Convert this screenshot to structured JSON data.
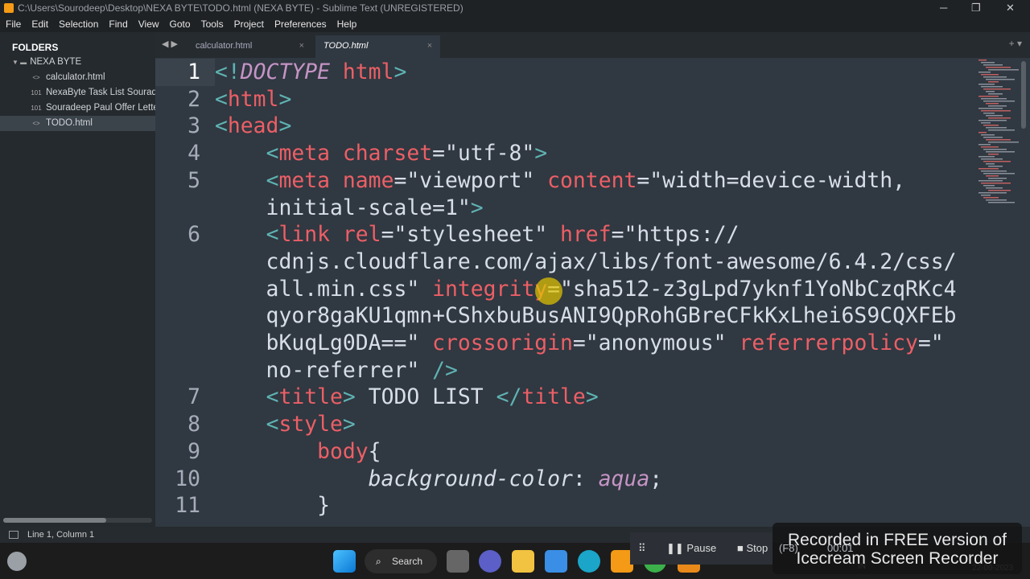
{
  "window": {
    "title": "C:\\Users\\Sourodeep\\Desktop\\NEXA BYTE\\TODO.html (NEXA BYTE) - Sublime Text (UNREGISTERED)",
    "min": "─",
    "max": "❐",
    "close": "✕"
  },
  "menu": [
    "File",
    "Edit",
    "Selection",
    "Find",
    "View",
    "Goto",
    "Tools",
    "Project",
    "Preferences",
    "Help"
  ],
  "sidebar": {
    "header": "FOLDERS",
    "folder": "NEXA BYTE",
    "files": [
      {
        "name": "calculator.html",
        "icon": "<>"
      },
      {
        "name": "NexaByte Task List Sourade",
        "icon": "101"
      },
      {
        "name": "Souradeep Paul Offer Lette",
        "icon": "101"
      },
      {
        "name": "TODO.html",
        "icon": "<>"
      }
    ]
  },
  "tabs": [
    {
      "label": "calculator.html"
    },
    {
      "label": "TODO.html"
    }
  ],
  "tab_close": "×",
  "code": [
    {
      "n": "1",
      "toks": [
        [
          "p",
          "<!"
        ],
        [
          "k",
          "DOCTYPE "
        ],
        [
          "n",
          "html"
        ],
        [
          "p",
          ">"
        ]
      ]
    },
    {
      "n": "2",
      "toks": [
        [
          "p",
          "<"
        ],
        [
          "n",
          "html"
        ],
        [
          "p",
          ">"
        ]
      ]
    },
    {
      "n": "3",
      "toks": [
        [
          "p",
          "<"
        ],
        [
          "n",
          "head"
        ],
        [
          "p",
          ">"
        ]
      ]
    },
    {
      "n": "4",
      "toks": [
        [
          "s",
          "    "
        ],
        [
          "p",
          "<"
        ],
        [
          "n",
          "meta "
        ],
        [
          "a",
          "charset"
        ],
        [
          "e",
          "="
        ],
        [
          "s",
          "\"utf-8\""
        ],
        [
          "p",
          ">"
        ]
      ]
    },
    {
      "n": "5",
      "toks": [
        [
          "s",
          "    "
        ],
        [
          "p",
          "<"
        ],
        [
          "n",
          "meta "
        ],
        [
          "a",
          "name"
        ],
        [
          "e",
          "="
        ],
        [
          "s",
          "\"viewport\" "
        ],
        [
          "a",
          "content"
        ],
        [
          "e",
          "="
        ],
        [
          "s",
          "\"width=device-width,"
        ]
      ]
    },
    {
      "n": "",
      "toks": [
        [
          "s",
          "    initial-scale=1\""
        ],
        [
          "p",
          ">"
        ]
      ]
    },
    {
      "n": "6",
      "toks": [
        [
          "s",
          "    "
        ],
        [
          "p",
          "<"
        ],
        [
          "n",
          "link "
        ],
        [
          "a",
          "rel"
        ],
        [
          "e",
          "="
        ],
        [
          "s",
          "\"stylesheet\" "
        ],
        [
          "a",
          "href"
        ],
        [
          "e",
          "="
        ],
        [
          "s",
          "\"https://"
        ]
      ]
    },
    {
      "n": "",
      "toks": [
        [
          "s",
          "    cdnjs.cloudflare.com/ajax/libs/font-awesome/6.4.2/css/"
        ]
      ]
    },
    {
      "n": "",
      "toks": [
        [
          "s",
          "    all.min.css\" "
        ],
        [
          "a",
          "integrity"
        ],
        [
          "e",
          "="
        ],
        [
          "s",
          "\"sha512-z3gLpd7yknf1YoNbCzqRKc4"
        ]
      ]
    },
    {
      "n": "",
      "toks": [
        [
          "s",
          "    qyor8gaKU1qmn+CShxbuBusANI9QpRohGBreCFkKxLhei6S9CQXFEb"
        ]
      ]
    },
    {
      "n": "",
      "toks": [
        [
          "s",
          "    bKuqLg0DA==\" "
        ],
        [
          "a",
          "crossorigin"
        ],
        [
          "e",
          "="
        ],
        [
          "s",
          "\"anonymous\" "
        ],
        [
          "a",
          "referrerpolicy"
        ],
        [
          "e",
          "="
        ],
        [
          "s",
          "\""
        ]
      ]
    },
    {
      "n": "",
      "toks": [
        [
          "s",
          "    no-referrer\" "
        ],
        [
          "p",
          "/>"
        ]
      ]
    },
    {
      "n": "7",
      "toks": [
        [
          "s",
          "    "
        ],
        [
          "p",
          "<"
        ],
        [
          "n",
          "title"
        ],
        [
          "p",
          "> "
        ],
        [
          "s",
          "TODO LIST "
        ],
        [
          "p",
          "</"
        ],
        [
          "n",
          "title"
        ],
        [
          "p",
          ">"
        ]
      ]
    },
    {
      "n": "8",
      "toks": [
        [
          "s",
          "    "
        ],
        [
          "p",
          "<"
        ],
        [
          "n",
          "style"
        ],
        [
          "p",
          ">"
        ]
      ]
    },
    {
      "n": "9",
      "toks": [
        [
          "s",
          "        "
        ],
        [
          "b",
          "body"
        ],
        [
          "e",
          "{"
        ]
      ]
    },
    {
      "n": "10",
      "toks": [
        [
          "s",
          "            "
        ],
        [
          "pr",
          "background-color"
        ],
        [
          "e",
          ": "
        ],
        [
          "v",
          "aqua"
        ],
        [
          "e",
          ";"
        ]
      ]
    },
    {
      "n": "11",
      "toks": [
        [
          "s",
          "        "
        ],
        [
          "e",
          "}"
        ]
      ]
    }
  ],
  "status": {
    "position": "Line 1, Column 1"
  },
  "taskbar": {
    "search": "Search",
    "lang": "IN",
    "date": "22-09-2023"
  },
  "recorder": {
    "pause": "Pause",
    "stop": "Stop",
    "stop_key": "(F8)",
    "time": "00:01"
  },
  "watermark": [
    "Recorded in FREE version of",
    "Icecream  Screen  Recorder"
  ]
}
